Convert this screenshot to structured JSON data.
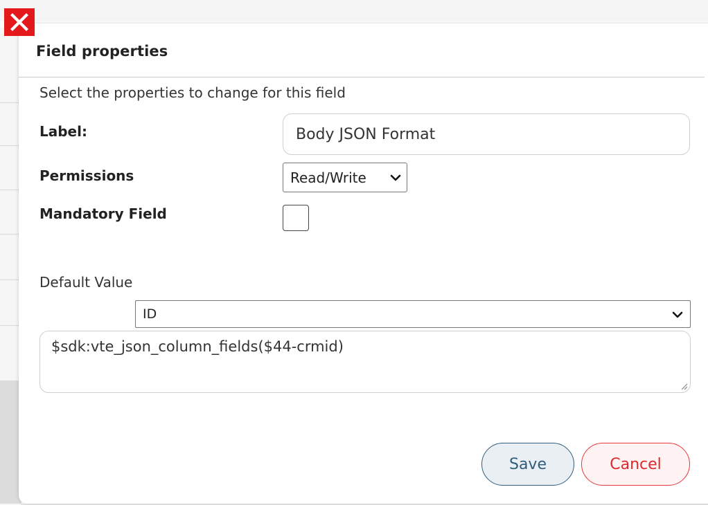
{
  "dialog": {
    "title": "Field properties",
    "subtitle": "Select the properties to change for this field"
  },
  "fields": {
    "label": {
      "label": "Label:",
      "value": "Body JSON Format"
    },
    "permissions": {
      "label": "Permissions",
      "selected": "Read/Write"
    },
    "mandatory": {
      "label": "Mandatory Field",
      "checked": false
    },
    "default_value": {
      "label": "Default Value",
      "selected": "ID",
      "value": "$sdk:vte_json_column_fields($44-crmid)"
    }
  },
  "buttons": {
    "save_label": "Save",
    "cancel_label": "Cancel"
  },
  "icons": {
    "close": "close-icon",
    "dropdown": "chevron-down-icon",
    "resize": "resize-grip-icon"
  },
  "colors": {
    "close_bg": "#e3191b",
    "save_border": "#2f5d7c",
    "cancel_border": "#e8373a"
  }
}
